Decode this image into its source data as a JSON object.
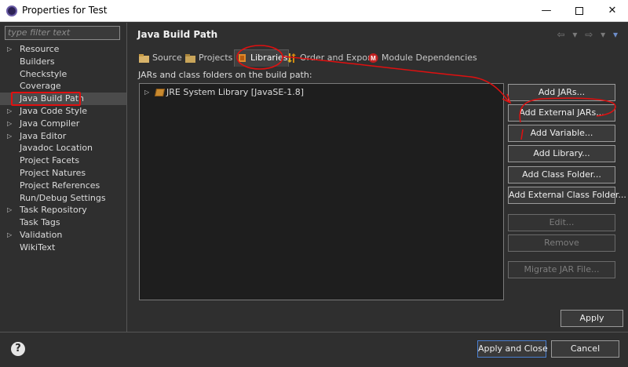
{
  "window": {
    "title": "Properties for Test",
    "minimize": "—",
    "close": "✕"
  },
  "sidebar": {
    "filter_placeholder": "type filter text",
    "items": [
      {
        "label": "Resource",
        "expandable": true
      },
      {
        "label": "Builders",
        "expandable": false
      },
      {
        "label": "Checkstyle",
        "expandable": false
      },
      {
        "label": "Coverage",
        "expandable": false
      },
      {
        "label": "Java Build Path",
        "expandable": false,
        "selected": true
      },
      {
        "label": "Java Code Style",
        "expandable": true
      },
      {
        "label": "Java Compiler",
        "expandable": true
      },
      {
        "label": "Java Editor",
        "expandable": true
      },
      {
        "label": "Javadoc Location",
        "expandable": false
      },
      {
        "label": "Project Facets",
        "expandable": false
      },
      {
        "label": "Project Natures",
        "expandable": false
      },
      {
        "label": "Project References",
        "expandable": false
      },
      {
        "label": "Run/Debug Settings",
        "expandable": false
      },
      {
        "label": "Task Repository",
        "expandable": true
      },
      {
        "label": "Task Tags",
        "expandable": false
      },
      {
        "label": "Validation",
        "expandable": true
      },
      {
        "label": "WikiText",
        "expandable": false
      }
    ]
  },
  "header": {
    "title": "Java Build Path",
    "nav": "⇦ ▾ ⇨ ▾ ▾"
  },
  "tabs": [
    {
      "label": "Source",
      "icon": "source-folder-icon"
    },
    {
      "label": "Projects",
      "icon": "projects-icon"
    },
    {
      "label": "Libraries",
      "icon": "libraries-icon",
      "active": true
    },
    {
      "label": "Order and Export",
      "icon": "order-export-icon"
    },
    {
      "label": "Module Dependencies",
      "icon": "module-icon"
    }
  ],
  "libraries": {
    "description": "JARs and class folders on the build path:",
    "entries": [
      {
        "label": "JRE System Library [JavaSE-1.8]"
      }
    ]
  },
  "buttons": {
    "add_jars": "Add JARs...",
    "add_external_jars": "Add External JARs...",
    "add_variable": "Add Variable...",
    "add_library": "Add Library...",
    "add_class_folder": "Add Class Folder...",
    "add_external_class_folder": "Add External Class Folder...",
    "edit": "Edit...",
    "remove": "Remove",
    "migrate_jar": "Migrate JAR File...",
    "apply": "Apply",
    "apply_and_close": "Apply and Close",
    "cancel": "Cancel"
  },
  "help_glyph": "?",
  "colors": {
    "annotation": "#e01010",
    "selection": "#4b4b4b",
    "primary_border": "#4a7fd0"
  }
}
